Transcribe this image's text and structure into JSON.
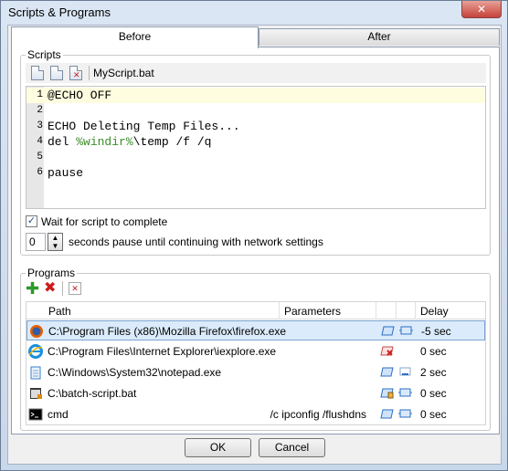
{
  "window": {
    "title": "Scripts & Programs",
    "close_label": "✕"
  },
  "tabs": [
    {
      "label": "Before"
    },
    {
      "label": "After"
    }
  ],
  "scripts": {
    "group_label": "Scripts",
    "script_name": "MyScript.bat",
    "toolbar_icons": [
      "new-script-icon",
      "copy-script-icon",
      "delete-script-icon"
    ],
    "lines": [
      {
        "num": "1",
        "parts": [
          "@ECHO OFF",
          "",
          ""
        ]
      },
      {
        "num": "2",
        "parts": [
          "",
          "",
          ""
        ]
      },
      {
        "num": "3",
        "parts": [
          "ECHO Deleting Temp Files...",
          "",
          ""
        ]
      },
      {
        "num": "4",
        "parts": [
          "del ",
          "%windir%",
          "\\temp /f /q"
        ]
      },
      {
        "num": "5",
        "parts": [
          "",
          "",
          ""
        ]
      },
      {
        "num": "6",
        "parts": [
          "pause",
          "",
          ""
        ]
      }
    ],
    "wait_checkbox_label": "Wait for script to complete",
    "wait_checked": true,
    "pause_value": "0",
    "pause_label": "seconds pause until continuing with network settings"
  },
  "programs": {
    "group_label": "Programs",
    "toolbar_icons": [
      "add-icon",
      "remove-icon",
      "clear-list-icon"
    ],
    "headers": {
      "path": "Path",
      "parameters": "Parameters",
      "delay": "Delay"
    },
    "rows": [
      {
        "icon": "firefox-icon",
        "path": "C:\\Program Files (x86)\\Mozilla Firefox\\firefox.exe",
        "params": "",
        "delay": "-5 sec"
      },
      {
        "icon": "internet-explorer-icon",
        "path": "C:\\Program Files\\Internet Explorer\\iexplore.exe",
        "params": "",
        "delay": "0 sec"
      },
      {
        "icon": "notepad-icon",
        "path": "C:\\Windows\\System32\\notepad.exe",
        "params": "",
        "delay": "2 sec"
      },
      {
        "icon": "batch-file-icon",
        "path": "C:\\batch-script.bat",
        "params": "",
        "delay": "0 sec"
      },
      {
        "icon": "command-prompt-icon",
        "path": "cmd",
        "params": "/c ipconfig /flushdns",
        "delay": "0 sec"
      }
    ]
  },
  "buttons": {
    "ok": "OK",
    "cancel": "Cancel"
  },
  "colors": {
    "accent": "#1b4f8f",
    "selection": "#dbebfb",
    "env_var": "#3b8d2a",
    "current_line": "#fefde0"
  }
}
